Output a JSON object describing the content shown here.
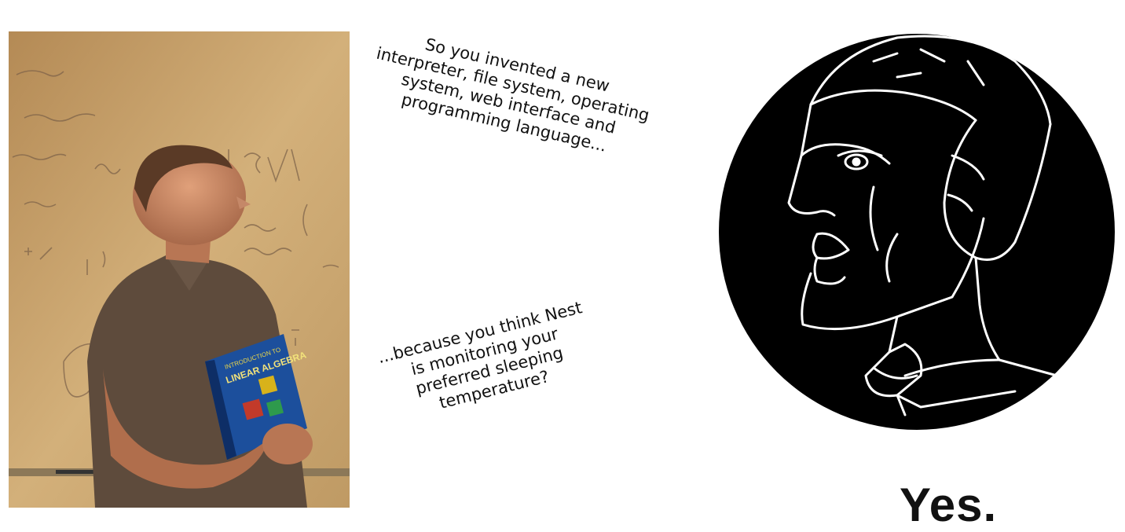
{
  "captions": {
    "top": "So you invented a new\ninterpreter, file system, operating\nsystem, web interface and\nprogramming language...",
    "bottom": "...because you think Nest\nis monitoring your\npreferred sleeping\ntemperature?"
  },
  "book": {
    "series": "INTRODUCTION TO",
    "title": "LINEAR ALGEBRA"
  },
  "yes": "Yes.",
  "colors": {
    "circle": "#000000",
    "lines": "#ffffff",
    "board": "#c8a470",
    "book": "#1c4f9c"
  }
}
